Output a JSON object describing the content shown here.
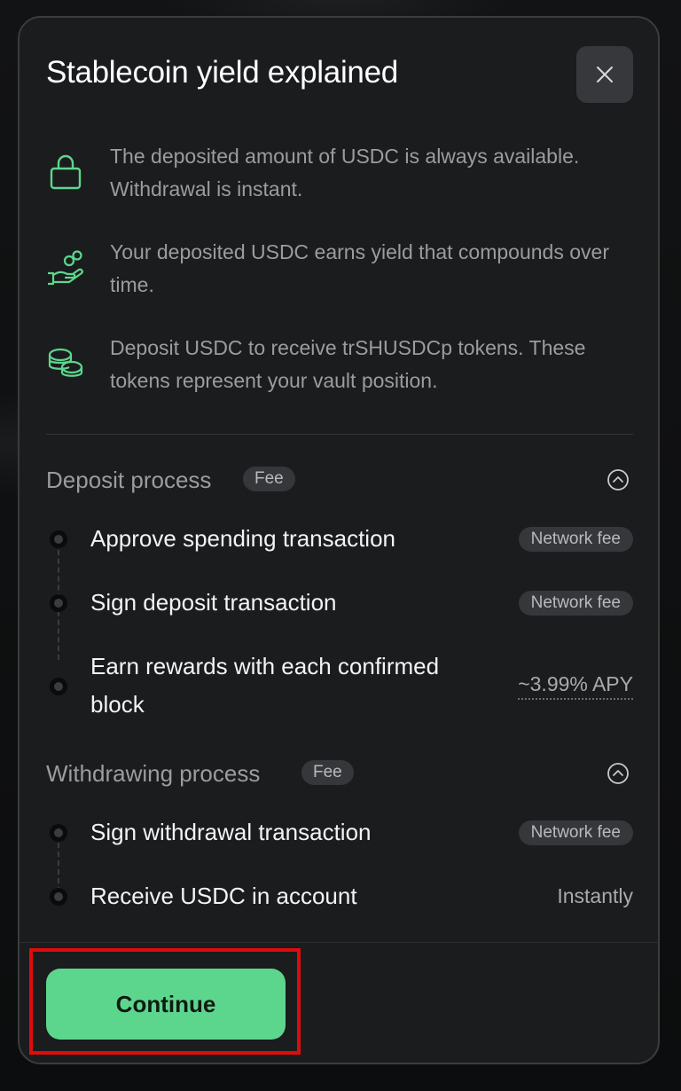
{
  "modal": {
    "title": "Stablecoin yield explained",
    "close_icon": "close-icon"
  },
  "features": [
    {
      "icon": "lock-icon",
      "text": "The deposited amount of USDC is always available. Withdrawal is instant."
    },
    {
      "icon": "hand-coins-icon",
      "text": "Your deposited USDC earns yield that compounds over time."
    },
    {
      "icon": "coins-stack-icon",
      "text": "Deposit USDC to receive trSHUSDCp tokens. These tokens represent your vault position."
    }
  ],
  "deposit": {
    "title": "Deposit process",
    "badge": "Fee",
    "steps": [
      {
        "label": "Approve spending transaction",
        "value": "Network fee"
      },
      {
        "label": "Sign deposit transaction",
        "value": "Network fee"
      },
      {
        "label": "Earn rewards with each confirmed block",
        "value": "~3.99% APY"
      }
    ]
  },
  "withdraw": {
    "title": "Withdrawing process",
    "badge": "Fee",
    "steps": [
      {
        "label": "Sign withdrawal transaction",
        "value": "Network fee"
      },
      {
        "label": "Receive USDC in account",
        "value": "Instantly"
      }
    ]
  },
  "footer": {
    "continue_label": "Continue"
  },
  "colors": {
    "accent": "#5dd68d",
    "background": "#1b1c1e",
    "highlight": "#e00b0b"
  }
}
